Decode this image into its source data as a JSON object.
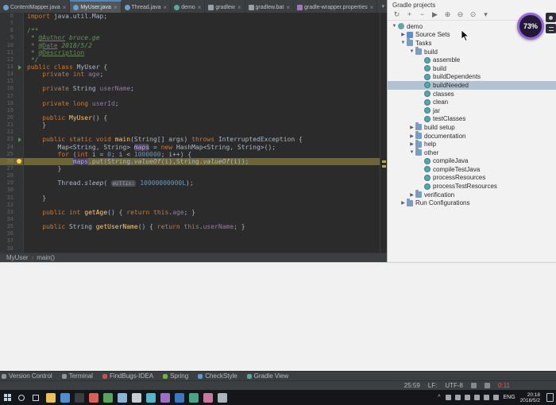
{
  "colors": {
    "editor-bg": "#2b2b2b",
    "gutter-bg": "#313335",
    "tabbar-bg": "#3c3f41",
    "active-tab-bg": "#515658",
    "accent-blue": "#4a88c7",
    "exec-line": "#6e6534",
    "occurrence-bg": "#4e3d66",
    "panel-bg": "#f2f2f2",
    "selection-bg": "#b2c2d1",
    "taskbar-bg": "#15161a",
    "recorder-purple": "#9465dd"
  },
  "editor_tabs": {
    "close_glyph": "×",
    "overflow_glyph": "▾",
    "tabs": [
      {
        "label": "ContentMapper.java",
        "icon": "class",
        "active": false
      },
      {
        "label": "MyUser.java",
        "icon": "class",
        "active": true
      },
      {
        "label": "Thread.java",
        "icon": "class",
        "active": false
      },
      {
        "label": "demo",
        "icon": "gradle",
        "active": false
      },
      {
        "label": "gradlew",
        "icon": "file",
        "active": false
      },
      {
        "label": "gradlew.bat",
        "icon": "file",
        "active": false
      },
      {
        "label": "gradle-wrapper.properties",
        "icon": "properties",
        "active": false
      }
    ]
  },
  "editor": {
    "breadcrumbs": [
      "MyUser",
      "main()"
    ],
    "lines": [
      {
        "n": 6,
        "seg": [
          [
            "k",
            "import"
          ],
          [
            "d",
            " java.util.Map;"
          ]
        ]
      },
      {
        "n": 7,
        "seg": []
      },
      {
        "n": 8,
        "seg": [
          [
            "c",
            "/**"
          ]
        ]
      },
      {
        "n": 9,
        "seg": [
          [
            "c",
            " * "
          ],
          [
            "dt",
            "@Author"
          ],
          [
            "dv",
            " bruce.ge"
          ]
        ]
      },
      {
        "n": 10,
        "seg": [
          [
            "c",
            " * "
          ],
          [
            "dt",
            "@Date"
          ],
          [
            "dv",
            " 2018/5/2"
          ]
        ]
      },
      {
        "n": 11,
        "seg": [
          [
            "c",
            " * "
          ],
          [
            "dt",
            "@Description"
          ]
        ]
      },
      {
        "n": 12,
        "seg": [
          [
            "c",
            " */"
          ]
        ]
      },
      {
        "n": 13,
        "marker": "run",
        "seg": [
          [
            "k",
            "public class"
          ],
          [
            "d",
            " MyUser {"
          ]
        ]
      },
      {
        "n": 14,
        "seg": [
          [
            "d",
            "    "
          ],
          [
            "k",
            "private int"
          ],
          [
            "d",
            " "
          ],
          [
            "f",
            "age"
          ],
          [
            "d",
            ";"
          ]
        ]
      },
      {
        "n": 15,
        "seg": []
      },
      {
        "n": 16,
        "seg": [
          [
            "d",
            "    "
          ],
          [
            "k",
            "private"
          ],
          [
            "d",
            " String "
          ],
          [
            "f",
            "userName"
          ],
          [
            "d",
            ";"
          ]
        ]
      },
      {
        "n": 17,
        "seg": []
      },
      {
        "n": 18,
        "seg": [
          [
            "d",
            "    "
          ],
          [
            "k",
            "private long"
          ],
          [
            "d",
            " "
          ],
          [
            "f",
            "userId"
          ],
          [
            "d",
            ";"
          ]
        ]
      },
      {
        "n": 19,
        "seg": []
      },
      {
        "n": 20,
        "seg": [
          [
            "d",
            "    "
          ],
          [
            "k",
            "public"
          ],
          [
            "d",
            " "
          ],
          [
            "m",
            "MyUser"
          ],
          [
            "d",
            "() {"
          ]
        ]
      },
      {
        "n": 21,
        "seg": [
          [
            "d",
            "    }"
          ]
        ]
      },
      {
        "n": 22,
        "seg": []
      },
      {
        "n": 23,
        "marker": "run",
        "seg": [
          [
            "d",
            "    "
          ],
          [
            "k",
            "public static void"
          ],
          [
            "d",
            " "
          ],
          [
            "m",
            "main"
          ],
          [
            "d",
            "(String[] args) "
          ],
          [
            "k",
            "throws"
          ],
          [
            "d",
            " InterruptedException {"
          ]
        ]
      },
      {
        "n": 24,
        "seg": [
          [
            "d",
            "        Map<String, String> "
          ],
          [
            "occ",
            "maps"
          ],
          [
            "d",
            " = "
          ],
          [
            "k",
            "new"
          ],
          [
            "d",
            " HashMap<String, String>();"
          ]
        ]
      },
      {
        "n": 25,
        "seg": [
          [
            "d",
            "        "
          ],
          [
            "k",
            "for"
          ],
          [
            "d",
            " ("
          ],
          [
            "k",
            "int"
          ],
          [
            "d",
            " i = "
          ],
          [
            "num",
            "0"
          ],
          [
            "d",
            "; i < "
          ],
          [
            "num",
            "1000000"
          ],
          [
            "d",
            "; i++) {"
          ]
        ]
      },
      {
        "n": 26,
        "hl": true,
        "marker": "bulb",
        "seg": [
          [
            "d",
            "            "
          ],
          [
            "occ",
            "maps"
          ],
          [
            "d",
            ".put(String."
          ],
          [
            "it",
            "valueOf"
          ],
          [
            "d",
            "(i),String."
          ],
          [
            "it",
            "valueOf"
          ],
          [
            "d",
            "(i));"
          ]
        ]
      },
      {
        "n": 27,
        "seg": [
          [
            "d",
            "        }"
          ]
        ]
      },
      {
        "n": 28,
        "seg": []
      },
      {
        "n": 29,
        "seg": [
          [
            "d",
            "        Thread."
          ],
          [
            "it",
            "sleep"
          ],
          [
            "d",
            "( "
          ],
          [
            "hint",
            "millis:"
          ],
          [
            "d",
            " "
          ],
          [
            "num",
            "10000000000L"
          ],
          [
            "d",
            ");"
          ]
        ]
      },
      {
        "n": 30,
        "seg": []
      },
      {
        "n": 31,
        "seg": [
          [
            "d",
            "    }"
          ]
        ]
      },
      {
        "n": 32,
        "seg": []
      },
      {
        "n": 33,
        "seg": [
          [
            "d",
            "    "
          ],
          [
            "k",
            "public int"
          ],
          [
            "d",
            " "
          ],
          [
            "m",
            "getAge"
          ],
          [
            "d",
            "() { "
          ],
          [
            "k",
            "return"
          ],
          [
            "d",
            " "
          ],
          [
            "k",
            "this"
          ],
          [
            "d",
            "."
          ],
          [
            "f",
            "age"
          ],
          [
            "d",
            "; }"
          ]
        ]
      },
      {
        "n": 34,
        "seg": []
      },
      {
        "n": 35,
        "seg": [
          [
            "d",
            "    "
          ],
          [
            "k",
            "public"
          ],
          [
            "d",
            " String "
          ],
          [
            "m",
            "getUserName"
          ],
          [
            "d",
            "() { "
          ],
          [
            "k",
            "return"
          ],
          [
            "d",
            " "
          ],
          [
            "k",
            "this"
          ],
          [
            "d",
            "."
          ],
          [
            "f",
            "userName"
          ],
          [
            "d",
            "; }"
          ]
        ]
      },
      {
        "n": 36,
        "seg": []
      },
      {
        "n": 37,
        "seg": []
      },
      {
        "n": 38,
        "seg": []
      }
    ]
  },
  "chevrons": {
    "expanded": "▼",
    "collapsed": "▶",
    "none": ""
  },
  "gradle_panel": {
    "title": "Gradle projects",
    "toolbar": [
      {
        "name": "refresh-gradle-icon",
        "glyph": "↻"
      },
      {
        "name": "attach-gradle-project-icon",
        "glyph": "+"
      },
      {
        "name": "detach-gradle-project-icon",
        "glyph": "−"
      },
      {
        "name": "run-gradle-task-icon",
        "glyph": "▶"
      },
      {
        "name": "expand-all-icon",
        "glyph": "⊕"
      },
      {
        "name": "collapse-all-icon",
        "glyph": "⊖"
      },
      {
        "name": "gradle-settings-icon",
        "glyph": "⊙"
      },
      {
        "name": "hide-panel-icon",
        "glyph": "▾"
      }
    ],
    "tree": [
      {
        "label": "demo",
        "depth": 0,
        "chevron": "expanded",
        "icon": "gradle"
      },
      {
        "label": "Source Sets",
        "depth": 1,
        "chevron": "collapsed",
        "icon": "sourcesets"
      },
      {
        "label": "Tasks",
        "depth": 1,
        "chevron": "expanded",
        "icon": "folder"
      },
      {
        "label": "build",
        "depth": 2,
        "chevron": "expanded",
        "icon": "folder"
      },
      {
        "label": "assemble",
        "depth": 3,
        "chevron": "none",
        "icon": "task"
      },
      {
        "label": "build",
        "depth": 3,
        "chevron": "none",
        "icon": "task"
      },
      {
        "label": "buildDependents",
        "depth": 3,
        "chevron": "none",
        "icon": "task"
      },
      {
        "label": "buildNeeded",
        "depth": 3,
        "chevron": "none",
        "icon": "task",
        "selected": true
      },
      {
        "label": "classes",
        "depth": 3,
        "chevron": "none",
        "icon": "task"
      },
      {
        "label": "clean",
        "depth": 3,
        "chevron": "none",
        "icon": "task"
      },
      {
        "label": "jar",
        "depth": 3,
        "chevron": "none",
        "icon": "task"
      },
      {
        "label": "testClasses",
        "depth": 3,
        "chevron": "none",
        "icon": "task"
      },
      {
        "label": "build setup",
        "depth": 2,
        "chevron": "collapsed",
        "icon": "folder"
      },
      {
        "label": "documentation",
        "depth": 2,
        "chevron": "collapsed",
        "icon": "folder"
      },
      {
        "label": "help",
        "depth": 2,
        "chevron": "collapsed",
        "icon": "folder"
      },
      {
        "label": "other",
        "depth": 2,
        "chevron": "expanded",
        "icon": "folder"
      },
      {
        "label": "compileJava",
        "depth": 3,
        "chevron": "none",
        "icon": "task"
      },
      {
        "label": "compileTestJava",
        "depth": 3,
        "chevron": "none",
        "icon": "task"
      },
      {
        "label": "processResources",
        "depth": 3,
        "chevron": "none",
        "icon": "task"
      },
      {
        "label": "processTestResources",
        "depth": 3,
        "chevron": "none",
        "icon": "task"
      },
      {
        "label": "verification",
        "depth": 2,
        "chevron": "collapsed",
        "icon": "folder"
      },
      {
        "label": "Run Configurations",
        "depth": 1,
        "chevron": "collapsed",
        "icon": "folder"
      }
    ]
  },
  "tool_windows": [
    {
      "label": "Version Control",
      "color": "#8f969b"
    },
    {
      "label": "Terminal",
      "color": "#8f969b"
    },
    {
      "label": "FindBugs-IDEA",
      "color": "#c75450"
    },
    {
      "label": "Spring",
      "color": "#6db33f"
    },
    {
      "label": "CheckStyle",
      "color": "#5b9bd5"
    },
    {
      "label": "Gradle View",
      "color": "#59a79e"
    }
  ],
  "status_bar": {
    "items": [
      {
        "name": "cursor-position",
        "text": "25:59"
      },
      {
        "name": "line-separator",
        "text": "LF:"
      },
      {
        "name": "encoding",
        "text": "UTF-8"
      },
      {
        "name": "readonly-lock-icon",
        "icon": true
      },
      {
        "name": "inspections-profile-icon",
        "icon": true
      },
      {
        "name": "recording-time",
        "text": "0:11",
        "color": "#e25b4e"
      }
    ]
  },
  "recorder": {
    "progress": "73%"
  },
  "taskbar": {
    "apps": [
      {
        "name": "file-explorer-icon",
        "color": "#e9c35a"
      },
      {
        "name": "browser-icon",
        "color": "#4e8fd1"
      },
      {
        "name": "ide-icon",
        "color": "#3a3d42"
      },
      {
        "name": "app-icon-4",
        "color": "#d95f57"
      },
      {
        "name": "app-icon-5",
        "color": "#58a55c"
      },
      {
        "name": "app-icon-6",
        "color": "#8ab4d8"
      },
      {
        "name": "app-icon-7",
        "color": "#c7cdd4"
      },
      {
        "name": "app-icon-8",
        "color": "#53b7c9"
      },
      {
        "name": "app-icon-9",
        "color": "#9a6fc4"
      },
      {
        "name": "app-icon-10",
        "color": "#3b78c3"
      },
      {
        "name": "app-icon-11",
        "color": "#46a687"
      },
      {
        "name": "app-icon-12",
        "color": "#c9799f"
      },
      {
        "name": "app-icon-13",
        "color": "#aab2ba"
      }
    ],
    "tray": {
      "chevron": "^",
      "icons": [
        "tray-icon-1",
        "tray-icon-2",
        "tray-icon-3",
        "tray-icon-4",
        "tray-icon-5",
        "tray-icon-6"
      ],
      "lang": "ENG",
      "time": "20:18",
      "date": "2018/5/2"
    }
  }
}
